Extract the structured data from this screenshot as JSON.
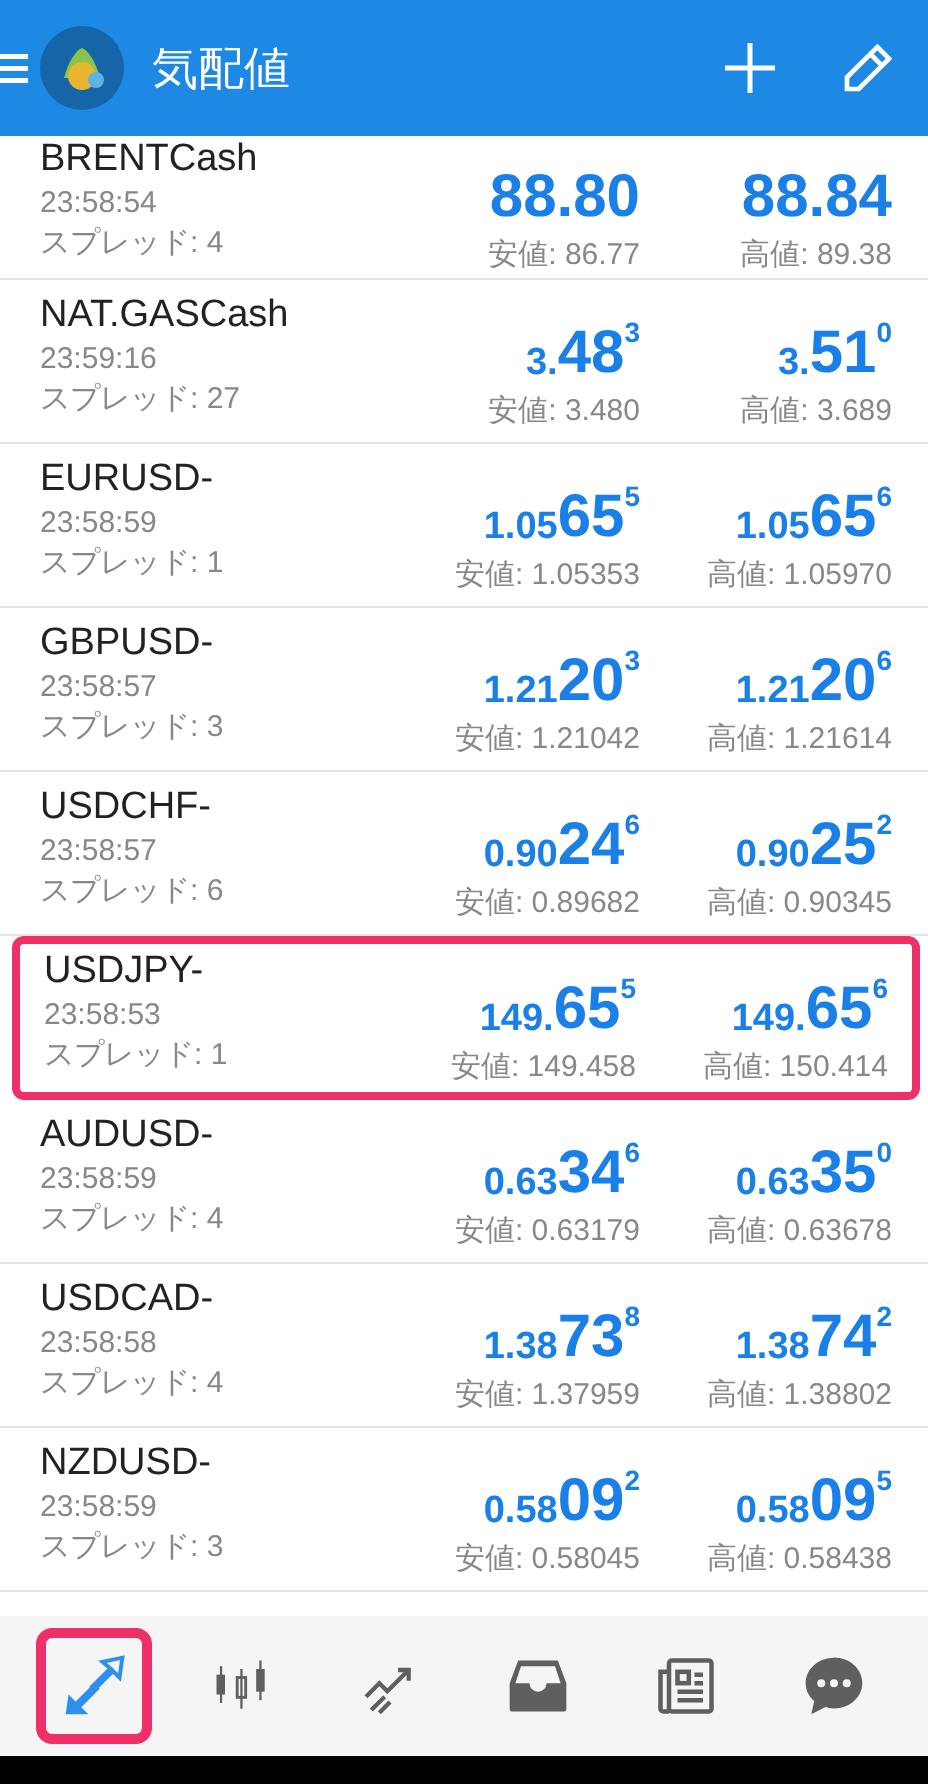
{
  "header": {
    "title": "気配値"
  },
  "quotes": [
    {
      "symbol": "BRENTCash",
      "time": "23:58:54",
      "spread": "スプレッド: 4",
      "bid": {
        "big": "88.80"
      },
      "ask": {
        "big": "88.84"
      },
      "low": "安値: 86.77",
      "high": "高値: 89.38",
      "highlighted": false
    },
    {
      "symbol": "NAT.GASCash",
      "time": "23:59:16",
      "spread": "スプレッド: 27",
      "bid": {
        "prefix": "3.",
        "big": "48",
        "sup": "3"
      },
      "ask": {
        "prefix": "3.",
        "big": "51",
        "sup": "0"
      },
      "low": "安値: 3.480",
      "high": "高値: 3.689",
      "highlighted": false
    },
    {
      "symbol": "EURUSD-",
      "time": "23:58:59",
      "spread": "スプレッド: 1",
      "bid": {
        "prefix": "1.05",
        "big": "65",
        "sup": "5"
      },
      "ask": {
        "prefix": "1.05",
        "big": "65",
        "sup": "6"
      },
      "low": "安値: 1.05353",
      "high": "高値: 1.05970",
      "highlighted": false
    },
    {
      "symbol": "GBPUSD-",
      "time": "23:58:57",
      "spread": "スプレッド: 3",
      "bid": {
        "prefix": "1.21",
        "big": "20",
        "sup": "3"
      },
      "ask": {
        "prefix": "1.21",
        "big": "20",
        "sup": "6"
      },
      "low": "安値: 1.21042",
      "high": "高値: 1.21614",
      "highlighted": false
    },
    {
      "symbol": "USDCHF-",
      "time": "23:58:57",
      "spread": "スプレッド: 6",
      "bid": {
        "prefix": "0.90",
        "big": "24",
        "sup": "6"
      },
      "ask": {
        "prefix": "0.90",
        "big": "25",
        "sup": "2"
      },
      "low": "安値: 0.89682",
      "high": "高値: 0.90345",
      "highlighted": false
    },
    {
      "symbol": "USDJPY-",
      "time": "23:58:53",
      "spread": "スプレッド: 1",
      "bid": {
        "prefix": "149.",
        "big": "65",
        "sup": "5"
      },
      "ask": {
        "prefix": "149.",
        "big": "65",
        "sup": "6"
      },
      "low": "安値: 149.458",
      "high": "高値: 150.414",
      "highlighted": true
    },
    {
      "symbol": "AUDUSD-",
      "time": "23:58:59",
      "spread": "スプレッド: 4",
      "bid": {
        "prefix": "0.63",
        "big": "34",
        "sup": "6"
      },
      "ask": {
        "prefix": "0.63",
        "big": "35",
        "sup": "0"
      },
      "low": "安値: 0.63179",
      "high": "高値: 0.63678",
      "highlighted": false
    },
    {
      "symbol": "USDCAD-",
      "time": "23:58:58",
      "spread": "スプレッド: 4",
      "bid": {
        "prefix": "1.38",
        "big": "73",
        "sup": "8"
      },
      "ask": {
        "prefix": "1.38",
        "big": "74",
        "sup": "2"
      },
      "low": "安値: 1.37959",
      "high": "高値: 1.38802",
      "highlighted": false
    },
    {
      "symbol": "NZDUSD-",
      "time": "23:58:59",
      "spread": "スプレッド: 3",
      "bid": {
        "prefix": "0.58",
        "big": "09",
        "sup": "2"
      },
      "ask": {
        "prefix": "0.58",
        "big": "09",
        "sup": "5"
      },
      "low": "安値: 0.58045",
      "high": "高値: 0.58438",
      "highlighted": false
    }
  ],
  "nav": [
    {
      "kind": "quotes",
      "selected": true,
      "highlighted": true
    },
    {
      "kind": "chart",
      "selected": false,
      "highlighted": false
    },
    {
      "kind": "trade",
      "selected": false,
      "highlighted": false
    },
    {
      "kind": "inbox",
      "selected": false,
      "highlighted": false
    },
    {
      "kind": "news",
      "selected": false,
      "highlighted": false
    },
    {
      "kind": "chat",
      "selected": false,
      "highlighted": false
    }
  ]
}
